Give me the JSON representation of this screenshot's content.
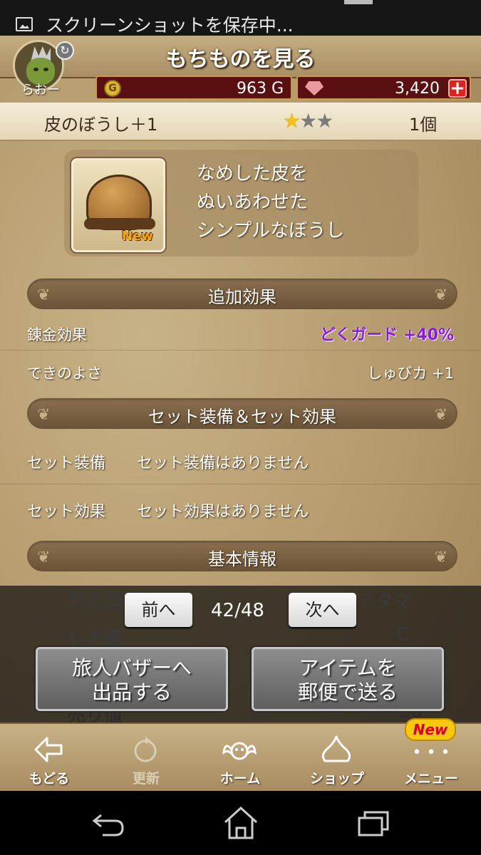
{
  "status_bar": {
    "notification": "スクリーンショットを保存中...",
    "notification_icon": "image-icon"
  },
  "header": {
    "title": "もちものを見る",
    "player_name": "らおー",
    "gold": "963 G",
    "gems": "3,420",
    "plus": "+"
  },
  "item": {
    "name": "皮のぼうし＋1",
    "rarity_stars": 1,
    "rarity_max": 3,
    "count": "1個",
    "new_label": "New",
    "description": [
      "なめした皮を",
      "ぬいあわせた",
      "シンプルなぼうし"
    ]
  },
  "sections": {
    "extra_effects": "追加効果",
    "set": "セット装備＆セット効果",
    "basic_info": "基本情報"
  },
  "effects": [
    {
      "key": "錬金効果",
      "value": "どくガード +40%"
    },
    {
      "key": "できのよさ",
      "value": "しゅびカ +1"
    }
  ],
  "set_rows": [
    {
      "key": "セット装備",
      "value": "セット装備はありません"
    },
    {
      "key": "セット効果",
      "value": "セット効果はありません"
    }
  ],
  "basic_rows": [
    {
      "key": "カテゴリ",
      "value": "アタマ"
    },
    {
      "key": "レア度",
      "value": "C"
    },
    {
      "key": "売り値",
      "value": "50"
    }
  ],
  "pager": {
    "prev": "前へ",
    "next": "次へ",
    "indicator": "42/48"
  },
  "actions": {
    "bazaar_line1": "旅人バザーへ",
    "bazaar_line2": "出品する",
    "mail_line1": "アイテムを",
    "mail_line2": "郵便で送る"
  },
  "nav": {
    "back": "もどる",
    "refresh": "更新",
    "home": "ホーム",
    "shop": "ショップ",
    "menu": "メニュー",
    "menu_badge": "New",
    "menu_dots": "• • •"
  },
  "colors": {
    "accent_red": "#5a1010",
    "effect_purple": "#8a1ad6",
    "star_gold": "#f2c21a"
  }
}
